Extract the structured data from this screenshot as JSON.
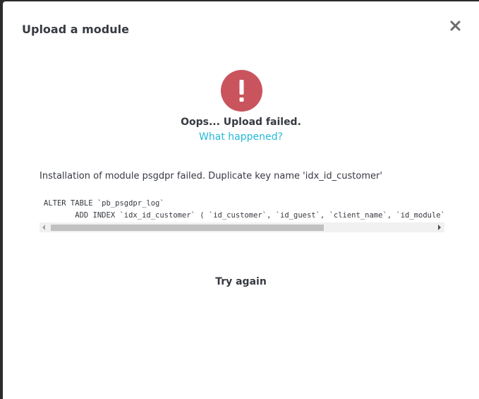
{
  "modal": {
    "title": "Upload a module"
  },
  "status": {
    "icon": "exclamation-icon",
    "accent_color": "#c9545e",
    "title": "Oops... Upload failed.",
    "link_label": "What happened?",
    "link_color": "#25b9d7"
  },
  "error": {
    "message": "Installation of module psgdpr failed. Duplicate key name 'idx_id_customer'",
    "code_lines": [
      "ALTER TABLE `pb_psgdpr_log`",
      "       ADD INDEX `idx_id_customer` ( `id_customer`, `id_guest`, `client_name`, `id_module`"
    ]
  },
  "actions": {
    "try_again_label": "Try again"
  }
}
